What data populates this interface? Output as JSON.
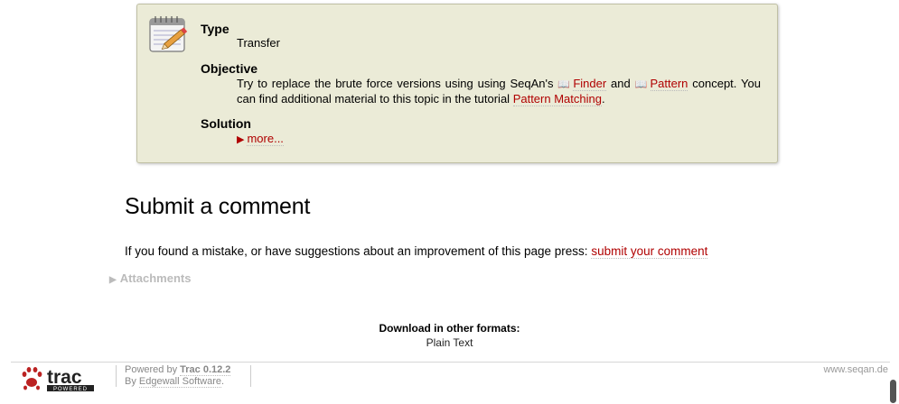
{
  "assignment": {
    "type_label": "Type",
    "type_value": "Transfer",
    "objective_label": "Objective",
    "objective_text_1": "Try to replace the brute force versions using using SeqAn's",
    "finder_link": "Finder",
    "and_text": "and",
    "pattern_link": "Pattern",
    "objective_text_2": "concept. You can find additional material to this topic in the tutorial",
    "pattern_matching_link": "Pattern Matching",
    "period": ".",
    "solution_label": "Solution",
    "more_link": "more..."
  },
  "comment_section": {
    "title": "Submit a comment",
    "text": "If you found a mistake, or have suggestions about an improvement of this page press:",
    "link": "submit your comment"
  },
  "attachments": {
    "label": "Attachments"
  },
  "formats": {
    "title": "Download in other formats:",
    "plain_text": "Plain Text"
  },
  "footer": {
    "powered_by": "Powered by",
    "trac_version": "Trac 0.12.2",
    "by": "By",
    "edgewall": "Edgewall Software",
    "period": ".",
    "site": "www.seqan.de",
    "logo_text": "trac",
    "logo_sub": "POWERED"
  },
  "colors": {
    "link": "#b00000",
    "box_bg": "#ebebd7"
  }
}
